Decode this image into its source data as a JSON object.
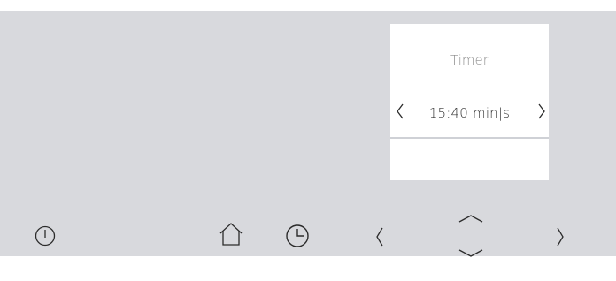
{
  "display": {
    "title": "Timer",
    "value": "15:40 min|s",
    "prev_icon": "chevron-left-icon",
    "next_icon": "chevron-right-icon"
  },
  "controls": {
    "power_icon": "power-icon",
    "home_icon": "home-icon",
    "timer_icon": "clock-icon",
    "left_icon": "chevron-left-icon",
    "up_icon": "chevron-up-icon",
    "down_icon": "chevron-down-icon",
    "right_icon": "chevron-right-icon"
  },
  "colors": {
    "panel": "#d8d9dd",
    "display_bg": "#ffffff",
    "icon_stroke": "#2b2b2b",
    "title_text": "#8c8c8c",
    "value_text": "#333333",
    "divider": "#cfd1d6"
  }
}
